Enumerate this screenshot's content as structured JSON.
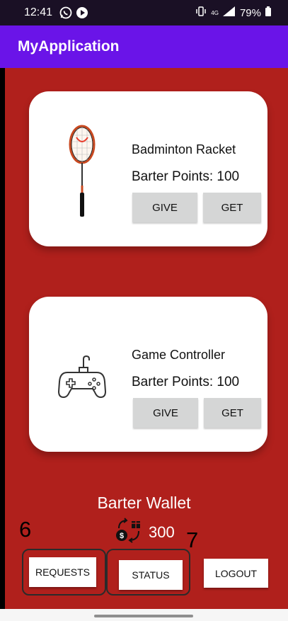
{
  "status_bar": {
    "time": "12:41",
    "network": "4G",
    "battery": "79%"
  },
  "app_bar": {
    "title": "MyApplication"
  },
  "items": [
    {
      "name": "Badminton Racket",
      "points": "Barter Points: 100",
      "give": "GIVE",
      "get": "GET",
      "icon": "badminton-racket"
    },
    {
      "name": "Game Controller",
      "points": "Barter Points: 100",
      "give": "GIVE",
      "get": "GET",
      "icon": "game-controller"
    }
  ],
  "wallet": {
    "title": "Barter Wallet",
    "balance": "300",
    "icon": "exchange-money-icon"
  },
  "annotations": {
    "left": "6",
    "right": "7"
  },
  "actions": {
    "requests": "REQUESTS",
    "status": "STATUS",
    "logout": "LOGOUT"
  },
  "colors": {
    "background": "#b0201c",
    "app_bar": "#6a14e8",
    "button": "#d5d6d6"
  }
}
